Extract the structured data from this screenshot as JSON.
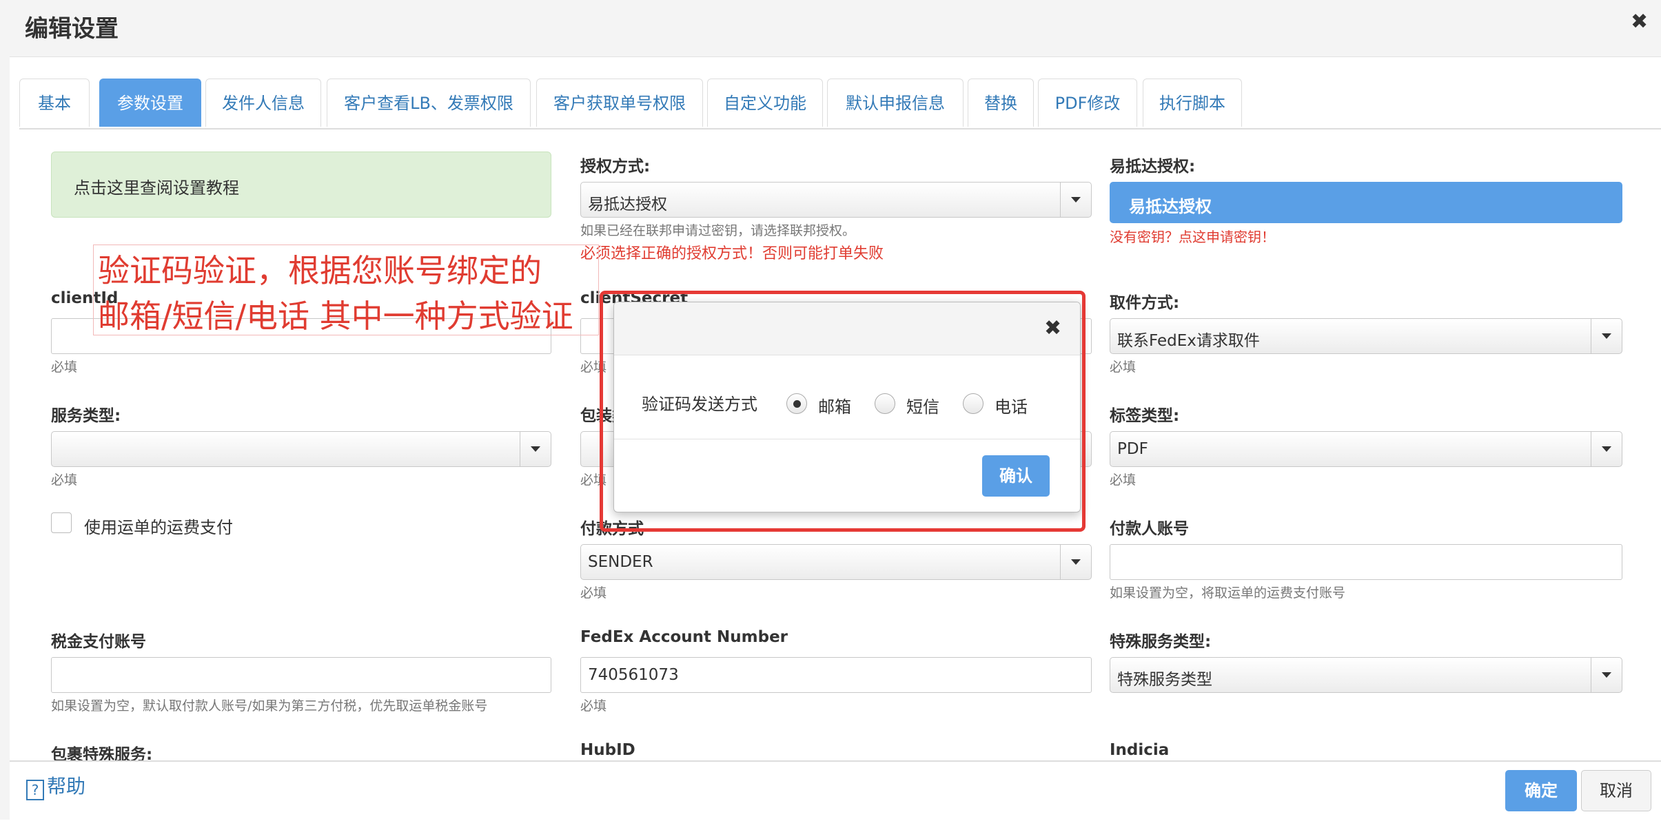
{
  "dialog_title": "编辑设置",
  "tabs": [
    "基本",
    "参数设置",
    "发件人信息",
    "客户查看LB、发票权限",
    "客户获取单号权限",
    "自定义功能",
    "默认申报信息",
    "替换",
    "PDF修改",
    "执行脚本"
  ],
  "active_tab": "参数设置",
  "tutorial_link": "点击这里查阅设置教程",
  "auth_method": {
    "label": "授权方式:",
    "value": "易抵达授权",
    "hint": "如果已经在联邦申请过密钥，请选择联邦授权。",
    "warning": "必须选择正确的授权方式！否则可能打单失败"
  },
  "easy_auth": {
    "label": "易抵达授权:",
    "button": "易抵达授权",
    "no_key_link": "没有密钥？点这申请密钥！"
  },
  "annotation": {
    "line1": "验证码验证，根据您账号绑定的",
    "line2": "邮箱/短信/电话 其中一种方式验证"
  },
  "client_id": {
    "label": "clientId",
    "hint": "必填"
  },
  "client_secret": {
    "label": "clientSecret",
    "hint": "必填"
  },
  "pickup": {
    "label": "取件方式:",
    "value": "联系FedEx请求取件",
    "hint": "必填"
  },
  "service_type": {
    "label": "服务类型:",
    "value": "",
    "hint": "必填"
  },
  "package_type": {
    "label": "包装类型:",
    "hint": "必填"
  },
  "label_type": {
    "label": "标签类型:",
    "value": "PDF",
    "hint": "必填"
  },
  "use_waybill_payment": "使用运单的运费支付",
  "payment_method": {
    "label": "付款方式",
    "value": "SENDER",
    "hint": "必填"
  },
  "payer_account": {
    "label": "付款人账号",
    "value": "",
    "hint": "如果设置为空，将取运单的运费支付账号"
  },
  "tax_account": {
    "label": "税金支付账号",
    "value": "",
    "hint": "如果设置为空，默认取付款人账号/如果为第三方付税，优先取运单税金账号"
  },
  "fedex_account": {
    "label": "FedEx Account Number",
    "value": "740561073",
    "hint": "必填"
  },
  "special_service": {
    "label": "特殊服务类型:",
    "value": "特殊服务类型"
  },
  "package_special": {
    "label": "包裹特殊服务:"
  },
  "hub_id": {
    "label": "HubID"
  },
  "indicia": {
    "label": "Indicia"
  },
  "verify_dialog": {
    "label": "验证码发送方式",
    "options": [
      "邮箱",
      "短信",
      "电话"
    ],
    "selected": "邮箱",
    "confirm": "确认"
  },
  "footer": {
    "help": "帮助",
    "ok": "确定",
    "cancel": "取消"
  },
  "colors": {
    "primary": "#5a9fe6",
    "error": "#e03c31",
    "alert_bg": "#dff0d8",
    "link": "#337ab7"
  }
}
